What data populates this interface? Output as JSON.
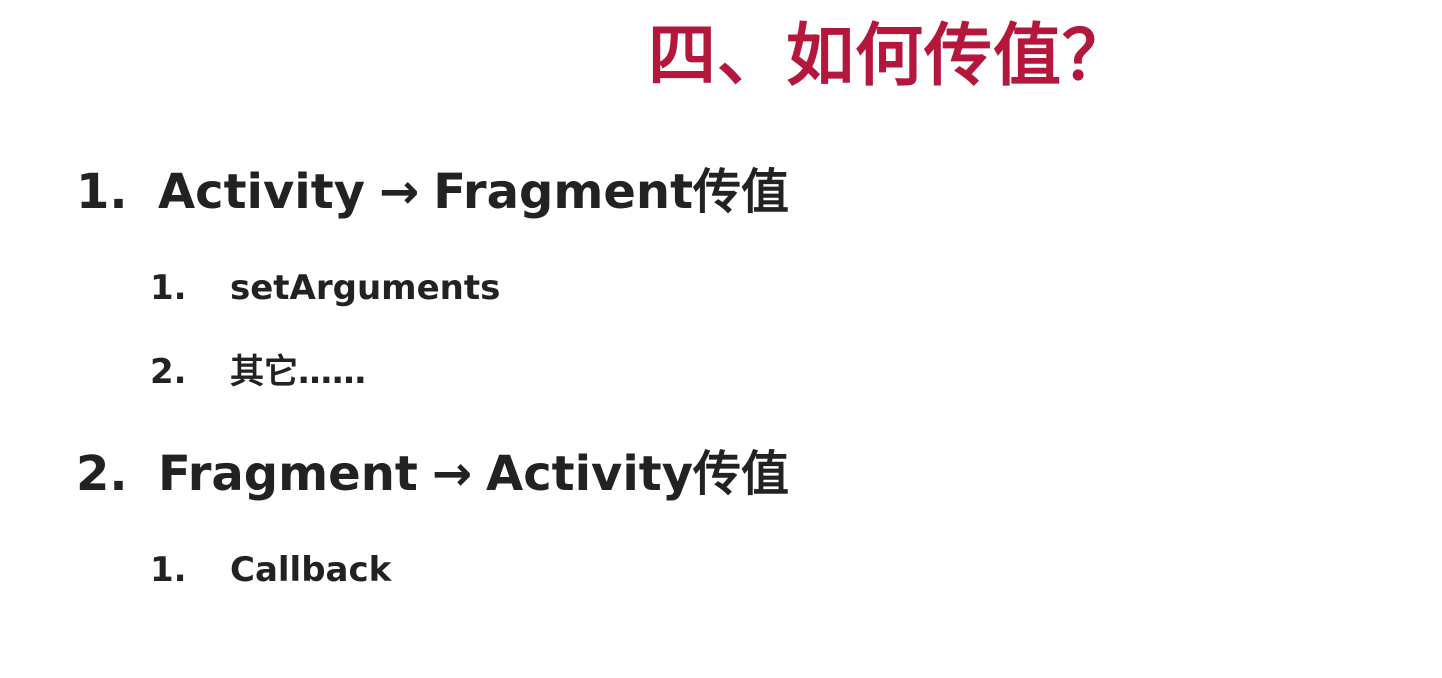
{
  "title": {
    "text": "四、如何传值？"
  },
  "sections": [
    {
      "number": "1.",
      "from": "Activity",
      "arrow": "→",
      "to": "Fragment传值",
      "items": [
        {
          "number": "1.",
          "text": "setArguments"
        },
        {
          "number": "2.",
          "text": "其它……"
        }
      ]
    },
    {
      "number": "2.",
      "from": "Fragment",
      "arrow": "→",
      "to": "Activity传值",
      "items": [
        {
          "number": "1.",
          "text": "Callback"
        }
      ]
    }
  ],
  "colors": {
    "title": "#b5163c",
    "text": "#222222",
    "background": "#ffffff"
  }
}
